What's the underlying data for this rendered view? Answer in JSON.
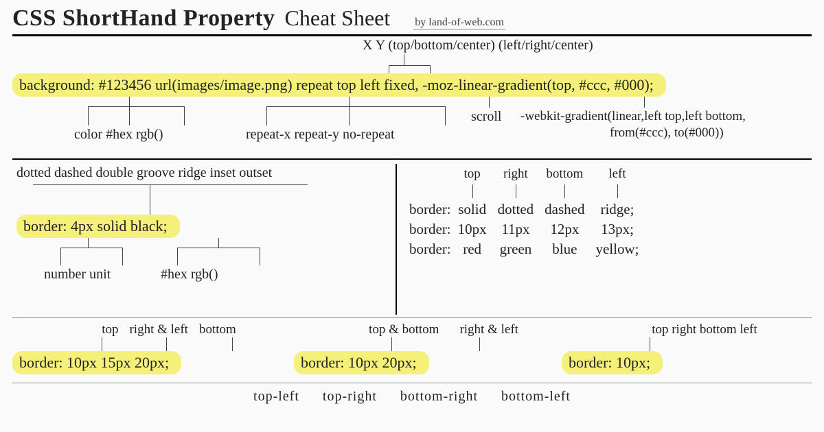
{
  "title": {
    "a": "CSS ShortHand Property",
    "b": "Cheat Sheet",
    "byline": "by land-of-web.com"
  },
  "bg": {
    "pos_hint": "X Y   (top/bottom/center) (left/right/center)",
    "code": "background:  #123456  url(images/image.png)  repeat  top  left  fixed,  -moz-linear-gradient(top,  #ccc,  #000);",
    "color_alts": "color  #hex  rgb()",
    "repeat_alts": "repeat-x   repeat-y   no-repeat",
    "attach_alt": "scroll",
    "webkit1": "-webkit-gradient(linear,left top,left bottom,",
    "webkit2": "from(#ccc), to(#000))"
  },
  "border_left": {
    "style_alts": "dotted dashed double groove ridge inset outset",
    "code": "border: 4px   solid     black;",
    "width_alts": "number  unit",
    "color_alts": "#hex    rgb()"
  },
  "border_right": {
    "head": {
      "c1": "top",
      "c2": "right",
      "c3": "bottom",
      "c4": "left"
    },
    "r1": {
      "label": "border:",
      "c1": "solid",
      "c2": "dotted",
      "c3": "dashed",
      "c4": "ridge;"
    },
    "r2": {
      "label": "border:",
      "c1": "10px",
      "c2": "11px",
      "c3": "12px",
      "c4": "13px;"
    },
    "r3": {
      "label": "border:",
      "c1": "red",
      "c2": "green",
      "c3": "blue",
      "c4": "yellow;"
    }
  },
  "tri": {
    "g1": {
      "l1": "top",
      "l2": "right & left",
      "l3": "bottom",
      "code": "border: 10px     15px     20px;"
    },
    "g2": {
      "l1": "top & bottom",
      "l2": "right & left",
      "code": "border:  10px        20px;"
    },
    "g3": {
      "l1": "top right bottom left",
      "code": "border: 10px;"
    }
  },
  "corners": {
    "c1": "top-left",
    "c2": "top-right",
    "c3": "bottom-right",
    "c4": "bottom-left"
  }
}
